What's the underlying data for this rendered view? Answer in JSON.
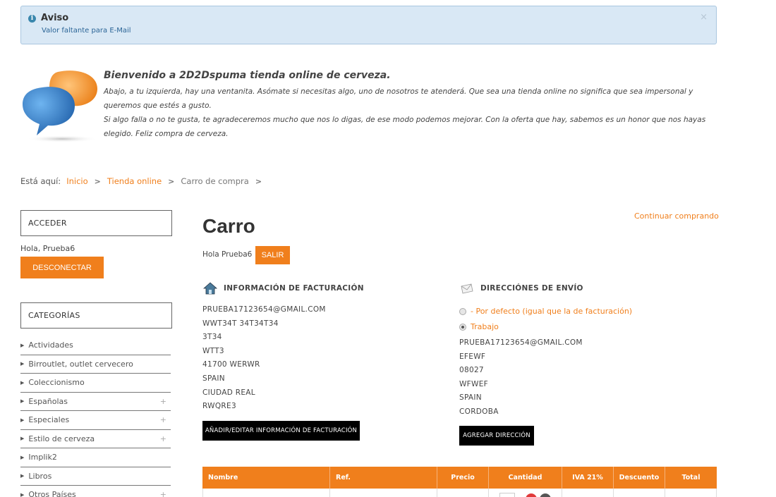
{
  "alert": {
    "title": "Aviso",
    "message": "Valor faltante para E-Mail",
    "close": "×"
  },
  "welcome": {
    "title": "Bienvenido a 2D2Dspuma tienda online de cerveza.",
    "line1": "Abajo, a tu izquierda, hay una ventanita. Asómate si necesitas algo, uno de nosotros te atenderá. Que sea una tienda online no significa que sea impersonal y queremos que estés a gusto.",
    "line2": "Si algo falla o no te gusta, te agradeceremos mucho que nos lo digas, de ese modo podemos mejorar. Con la oferta que hay, sabemos es un honor que nos hayas elegido. Feliz compra de cerveza."
  },
  "breadcrumb": {
    "label": "Está aquí:",
    "items": [
      "Inicio",
      "Tienda online",
      "Carro de compra"
    ],
    "sep": ">"
  },
  "sidebar": {
    "login_title": "ACCEDER",
    "hello": "Hola, Prueba6",
    "logout": "DESCONECTAR",
    "categories_title": "CATEGORÍAS",
    "categories": [
      {
        "label": "Actividades",
        "expand": ""
      },
      {
        "label": "Birroutlet, outlet cervecero",
        "expand": ""
      },
      {
        "label": "Coleccionismo",
        "expand": ""
      },
      {
        "label": "Españolas",
        "expand": "+"
      },
      {
        "label": "Especiales",
        "expand": "+"
      },
      {
        "label": "Estilo de cerveza",
        "expand": "+"
      },
      {
        "label": "Implik2",
        "expand": ""
      },
      {
        "label": "Libros",
        "expand": ""
      },
      {
        "label": "Otros Países",
        "expand": "+"
      }
    ]
  },
  "main": {
    "continue": "Continuar comprando",
    "title": "Carro",
    "hello": "Hola Prueba6",
    "logout": "SALIR",
    "billing": {
      "heading": "INFORMACIÓN DE FACTURACIÓN",
      "lines": [
        "PRUEBA17123654@GMAIL.COM",
        "WWT34T 34T34T34",
        "3T34",
        "WTT3",
        "41700 WERWR",
        "SPAIN",
        "CIUDAD REAL",
        "RWQRE3"
      ],
      "button": "AÑADIR/EDITAR INFORMACIÓN DE FACTURACIÓN"
    },
    "shipping": {
      "heading": "DIRECCIÓNES DE ENVÍO",
      "option_default": "- Por defecto (igual que la de facturación)",
      "option_work": "Trabajo",
      "selected": "Trabajo",
      "lines": [
        "PRUEBA17123654@GMAIL.COM",
        "EFEWF",
        "08027",
        "WFWEF",
        "SPAIN",
        "CORDOBA"
      ],
      "button": "AGREGAR DIRECCIÓN"
    },
    "table": {
      "headers": [
        "Nombre",
        "Ref.",
        "Precio",
        "Cantidad",
        "IVA 21%",
        "Descuento",
        "Total"
      ]
    }
  },
  "colors": {
    "accent": "#f07f1c",
    "alert_bg": "#d9e8f5"
  }
}
